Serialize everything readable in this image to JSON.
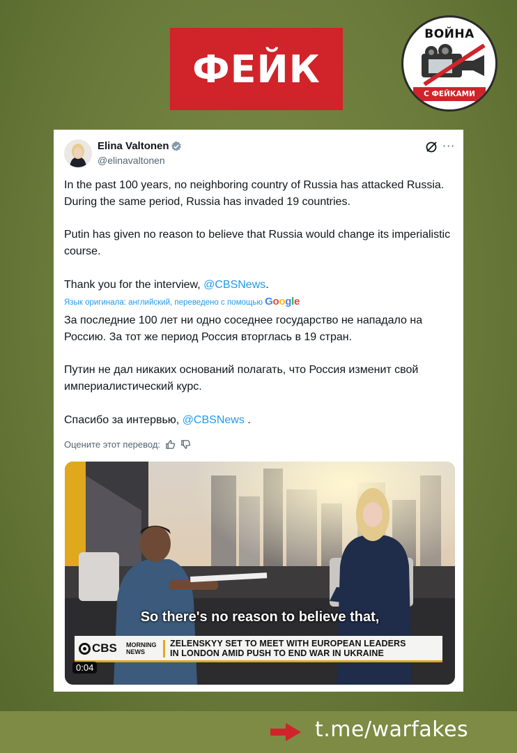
{
  "banner": {
    "label": "ФЕЙК",
    "color": "#d0232a"
  },
  "logo": {
    "top_text": "ВОЙНА",
    "bottom_text": "С ФЕЙКАМИ",
    "icon": "camera-crossed-icon"
  },
  "tweet": {
    "author_name": "Elina Valtonen",
    "handle": "@elinavaltonen",
    "verified_icon": "verified-badge-icon",
    "more_label": "···",
    "original": {
      "p1": "In the past 100 years, no neighboring country of Russia has attacked Russia. During the same period, Russia has invaded 19 countries.",
      "p2": "Putin has given no reason to believe that Russia would change its imperialistic course.",
      "p3_prefix": "Thank you for the interview, ",
      "p3_mention": "@CBSNews",
      "p3_suffix": "."
    },
    "translation_note": "Язык оригинала: английский, переведено с помощью",
    "translation_provider": "Google",
    "translated": {
      "p1": "За последние 100 лет ни одно соседнее государство не нападало на Россию. За тот же период Россия вторглась в 19 стран.",
      "p2": "Путин не дал никаких оснований полагать, что Россия изменит свой империалистический курс.",
      "p3_prefix": "Спасибо за интервью, ",
      "p3_mention": "@CBSNews",
      "p3_suffix": " ."
    },
    "rate_label": "Оцените этот перевод:"
  },
  "video": {
    "subtitle": "So there's no reason to believe that,",
    "cbs_logo": "CBS",
    "cbs_show_line1": "MORNING",
    "cbs_show_line2": "NEWS",
    "headline_line1": "ZELENSKYY SET TO MEET WITH EUROPEAN LEADERS",
    "headline_line2": "IN LONDON AMID PUSH TO END WAR IN UKRAINE",
    "duration": "0:04"
  },
  "footer": {
    "link": "t.me/warfakes"
  }
}
